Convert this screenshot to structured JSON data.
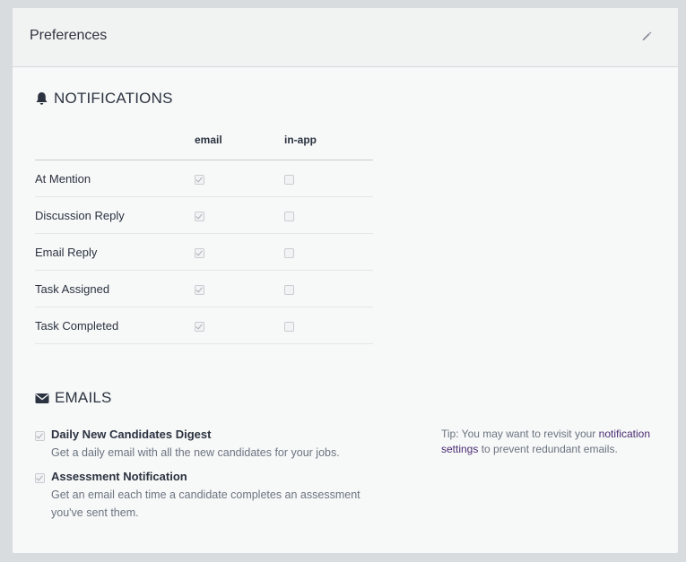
{
  "header": {
    "title": "Preferences",
    "edit_icon": "pencil-icon"
  },
  "notifications": {
    "title": "NOTIFICATIONS",
    "icon": "bell-icon",
    "columns": [
      "email",
      "in-app"
    ],
    "rows": [
      {
        "label": "At Mention",
        "email": true,
        "in_app": false
      },
      {
        "label": "Discussion Reply",
        "email": true,
        "in_app": false
      },
      {
        "label": "Email Reply",
        "email": true,
        "in_app": false
      },
      {
        "label": "Task Assigned",
        "email": true,
        "in_app": false
      },
      {
        "label": "Task Completed",
        "email": true,
        "in_app": false
      }
    ]
  },
  "emails": {
    "title": "EMAILS",
    "icon": "envelope-icon",
    "items": [
      {
        "name": "Daily New Candidates Digest",
        "description": "Get a daily email with all the new candidates for your jobs.",
        "checked": true
      },
      {
        "name": "Assessment Notification",
        "description": "Get an email each time a candidate completes an assessment you've sent them.",
        "checked": true
      }
    ]
  },
  "tip": {
    "prefix": "Tip: You may want to revisit your ",
    "link": "notification settings",
    "suffix": " to prevent redundant emails."
  },
  "colors": {
    "link": "#4a2d73",
    "panel": "#f7f8f8",
    "background": "#d8dcdf"
  }
}
